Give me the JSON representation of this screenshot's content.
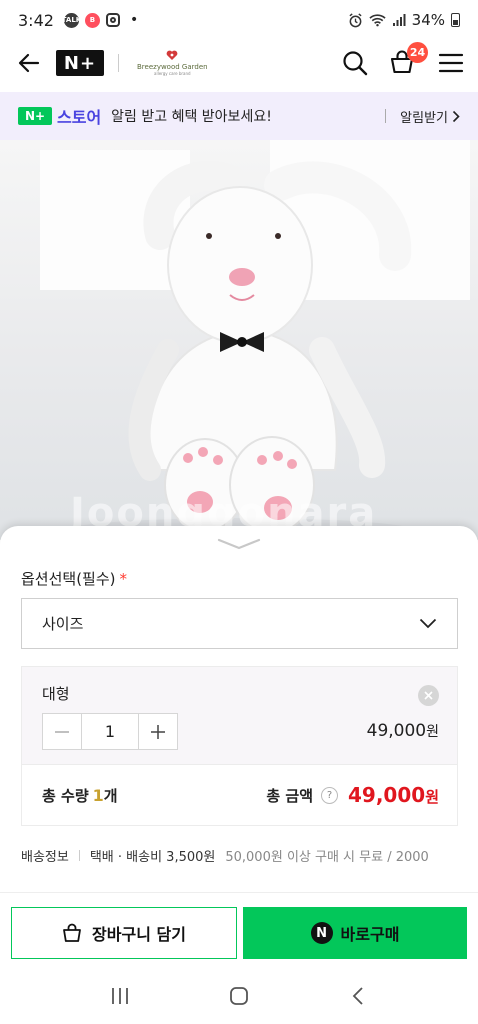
{
  "status_bar": {
    "time": "3:42",
    "battery": "34%",
    "talk_label": "TALK",
    "b_label": "B",
    "dot": "•"
  },
  "header": {
    "logo_text": "N+",
    "brand_name": "Breezywood Garden",
    "brand_sub": "allergy care brand",
    "cart_count": "24"
  },
  "promo": {
    "badge": "N+",
    "store": "스토어",
    "text": "알림 받고 혜택 받아보세요!",
    "link": "알림받기"
  },
  "product": {
    "watermark": "Joonggonara"
  },
  "options": {
    "label": "옵션선택(필수)",
    "required_mark": "*",
    "select_value": "사이즈",
    "selected_item": {
      "name": "대형",
      "quantity": "1",
      "price": "49,000",
      "currency": "원"
    }
  },
  "totals": {
    "qty_label": "총 수량",
    "qty_value": "1",
    "qty_unit": "개",
    "amount_label": "총 금액",
    "help": "?",
    "amount": "49,000",
    "currency": "원"
  },
  "shipping": {
    "label": "배송정보",
    "fee": "택배 · 배송비 3,500원",
    "free_condition": "50,000원 이상 구매 시 무료 / 2000"
  },
  "actions": {
    "cart_label": "장바구니 담기",
    "buy_icon": "N",
    "buy_label": "바로구매"
  },
  "colors": {
    "naver_green": "#03c75a",
    "price_red": "#e0161e",
    "badge_red": "#ff4f3f",
    "store_purple": "#4a43e0"
  }
}
